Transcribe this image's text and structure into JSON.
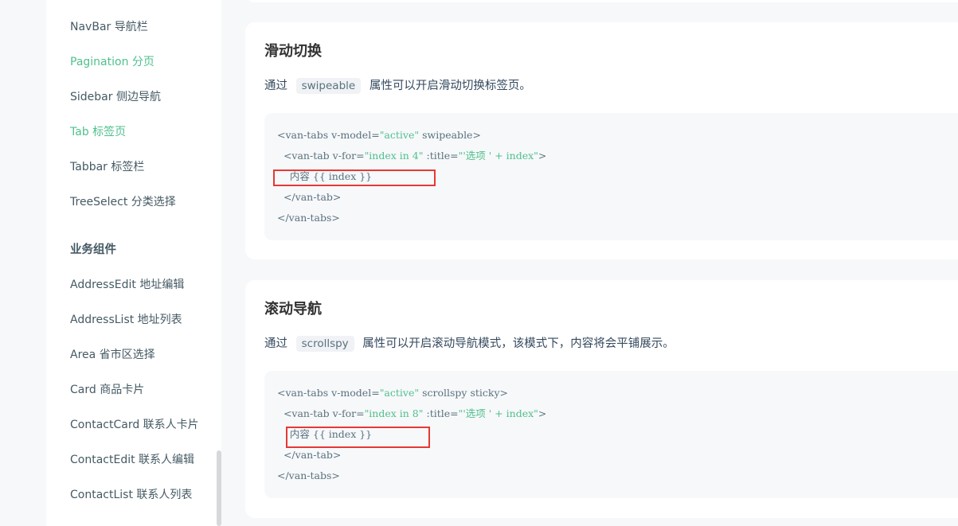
{
  "sidebar": {
    "items": [
      {
        "label": "NavBar 导航栏",
        "active": false
      },
      {
        "label": "Pagination 分页",
        "active": true
      },
      {
        "label": "Sidebar 侧边导航",
        "active": false
      },
      {
        "label": "Tab 标签页",
        "active": true
      },
      {
        "label": "Tabbar 标签栏",
        "active": false
      },
      {
        "label": "TreeSelect 分类选择",
        "active": false
      }
    ],
    "group_title": "业务组件",
    "group_items": [
      {
        "label": "AddressEdit 地址编辑"
      },
      {
        "label": "AddressList 地址列表"
      },
      {
        "label": "Area 省市区选择"
      },
      {
        "label": "Card 商品卡片"
      },
      {
        "label": "ContactCard 联系人卡片"
      },
      {
        "label": "ContactEdit 联系人编辑"
      },
      {
        "label": "ContactList 联系人列表"
      }
    ]
  },
  "sections": [
    {
      "title": "滑动切换",
      "desc_prefix": "通过",
      "desc_code": "swipeable",
      "desc_suffix": "属性可以开启滑动切换标签页。",
      "code": {
        "l1_tag": "<van-tabs ",
        "l1_attr": "v-model=",
        "l1_val": "\"active\"",
        "l1_rest": " swipeable>",
        "l2_tag": "  <van-tab ",
        "l2_attr": "v-for=",
        "l2_val": "\"index in 4\"",
        "l2_attr2": " :title=",
        "l2_val2": "\"'选项 ' + index\"",
        "l2_end": ">",
        "l3": "    内容 {{ index }}",
        "l4": "  </van-tab>",
        "l5": "</van-tabs>"
      }
    },
    {
      "title": "滚动导航",
      "desc_prefix": "通过",
      "desc_code": "scrollspy",
      "desc_suffix": "属性可以开启滚动导航模式，该模式下，内容将会平铺展示。",
      "code": {
        "l1_tag": "<van-tabs ",
        "l1_attr": "v-model=",
        "l1_val": "\"active\"",
        "l1_rest": " scrollspy sticky>",
        "l2_tag": "  <van-tab ",
        "l2_attr": "v-for=",
        "l2_val": "\"index in 8\"",
        "l2_attr2": " :title=",
        "l2_val2": "\"'选项 ' + index\"",
        "l2_end": ">",
        "l3": "    内容 {{ index }}",
        "l4": "  </van-tab>",
        "l5": "</van-tabs>"
      }
    }
  ],
  "colors": {
    "accent": "#4fc08d",
    "highlight_box": "#e53935",
    "text": "#455a64"
  }
}
